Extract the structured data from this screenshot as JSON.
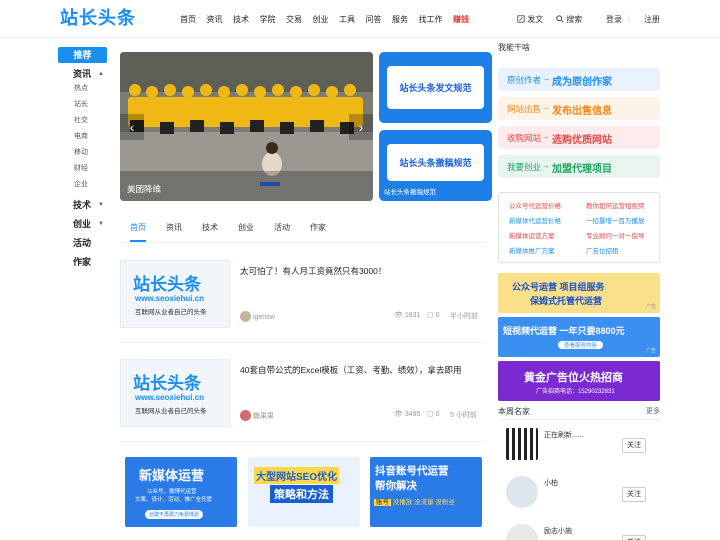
{
  "header": {
    "logo": "站长头条",
    "nav": [
      "首页",
      "资讯",
      "技术",
      "学院",
      "交易",
      "创业",
      "工具",
      "问答",
      "服务",
      "找工作",
      "赚钱"
    ],
    "post": "发文",
    "search": "搜索",
    "login": "登录",
    "register": "注册"
  },
  "left_menu": {
    "recommend": "推荐",
    "news": "资讯",
    "news_sub": [
      "热点",
      "站长",
      "社交",
      "电商",
      "移动",
      "财经",
      "企业"
    ],
    "tech": "技术",
    "startup": "创业",
    "activity": "活动",
    "author": "作家"
  },
  "carousel": {
    "caption": "美团降维"
  },
  "side_cards": [
    {
      "text": "站长头条发文规范"
    },
    {
      "text": "站长头条撤稿规范",
      "caption": "站长头条撤稿规范"
    }
  ],
  "tabs": [
    "首页",
    "资讯",
    "技术",
    "创业",
    "活动",
    "作家"
  ],
  "articles": [
    {
      "thumb_logo": "站长头条",
      "thumb_url": "www.seoxiehui.cn",
      "thumb_slogan": "互联网从业者自己的头条",
      "title": "太可怕了！有人月工资竟然只有3000！",
      "author": "igensw",
      "views": "1831",
      "comments": "0",
      "time": "半小时前"
    },
    {
      "thumb_logo": "站长头条",
      "thumb_url": "www.seoxiehui.cn",
      "thumb_slogan": "互联网从业者自己的头条",
      "title": "40套自带公式的Excel模板（工资、考勤、绩效），拿去即用",
      "author": "糖果果",
      "views": "3495",
      "comments": "0",
      "time": "5 小时前"
    }
  ],
  "bottom_banners": [
    {
      "title": "新媒体运营",
      "lines": [
        "公众号、微博代运营",
        "文案、设计、活动、推广全托管"
      ],
      "foot": "创建不再费力免费体验"
    },
    {
      "title": "大型网站SEO优化",
      "sub": "策略和方法"
    },
    {
      "title": "抖音账号代运营",
      "sub": "帮你解决",
      "tags": [
        "账号",
        "没播放",
        "没流量",
        "没粉丝"
      ]
    }
  ],
  "right": {
    "section_title": "我能干啥",
    "rows": [
      {
        "a": "原创作者",
        "b": "成为原创作家",
        "bg": "#eaf3fd",
        "acolor": "#1a8ff0"
      },
      {
        "a": "网站出售",
        "b": "发布出售信息",
        "bg": "#fdf3e6",
        "acolor": "#f08a1a"
      },
      {
        "a": "收购网站",
        "b": "选购优质网站",
        "bg": "#fdeaea",
        "acolor": "#e04848"
      },
      {
        "a": "我要创业",
        "b": "加盟代理项目",
        "bg": "#e8f5ee",
        "acolor": "#1fa463"
      }
    ],
    "links": [
      [
        "公众号代运营价格",
        "教你如何运营短视频"
      ],
      [
        "新媒体代运营价格",
        "一招暴增一百万播放"
      ],
      [
        "新媒体运营方案",
        "专业顾问一对一指导"
      ],
      [
        "新媒体推广方案",
        "广告位招租"
      ]
    ],
    "ads": [
      {
        "line1": "公众号运营  项目组服务",
        "line2": "保姆式托管代运营",
        "tag": "广告"
      },
      {
        "line1": "短视频代运营  一年只要8800元",
        "line2": "查看服务内容",
        "tag": "广告"
      },
      {
        "line1": "黄金广告位火热招商",
        "line2": "广告招商电话：15290232631"
      }
    ],
    "rank_title": "本周名家",
    "rank_more": "更多",
    "rank": [
      {
        "name": "正在刷新......",
        "follow": "关注"
      },
      {
        "name": "小柏",
        "follow": "关注"
      },
      {
        "name": "励志小施",
        "follow": "关注"
      }
    ]
  }
}
